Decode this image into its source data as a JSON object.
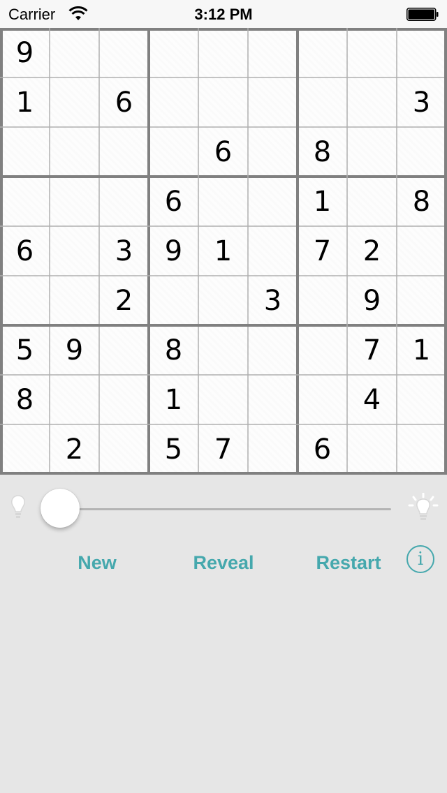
{
  "status_bar": {
    "carrier": "Carrier",
    "time": "3:12 PM"
  },
  "board": {
    "rows": [
      [
        "9",
        "",
        "",
        "",
        "",
        "",
        "",
        "",
        ""
      ],
      [
        "1",
        "",
        "6",
        "",
        "",
        "",
        "",
        "",
        "3"
      ],
      [
        "",
        "",
        "",
        "",
        "6",
        "",
        "8",
        "",
        ""
      ],
      [
        "",
        "",
        "",
        "6",
        "",
        "",
        "1",
        "",
        "8"
      ],
      [
        "6",
        "",
        "3",
        "9",
        "1",
        "",
        "7",
        "2",
        ""
      ],
      [
        "",
        "",
        "2",
        "",
        "",
        "3",
        "",
        "9",
        ""
      ],
      [
        "5",
        "9",
        "",
        "8",
        "",
        "",
        "",
        "7",
        "1"
      ],
      [
        "8",
        "",
        "",
        "1",
        "",
        "",
        "",
        "4",
        ""
      ],
      [
        "",
        "2",
        "",
        "5",
        "7",
        "",
        "6",
        "",
        ""
      ]
    ]
  },
  "hint_slider": {
    "level": 0,
    "min_icon": "bulb-off-icon",
    "max_icon": "bulb-on-icon"
  },
  "buttons": {
    "new": "New",
    "reveal": "Reveal",
    "restart": "Restart",
    "info": "i"
  },
  "colors": {
    "accent": "#45a8ad",
    "background": "#e6e6e6",
    "grid_line": "#b0b0b0",
    "box_line": "#808080"
  }
}
